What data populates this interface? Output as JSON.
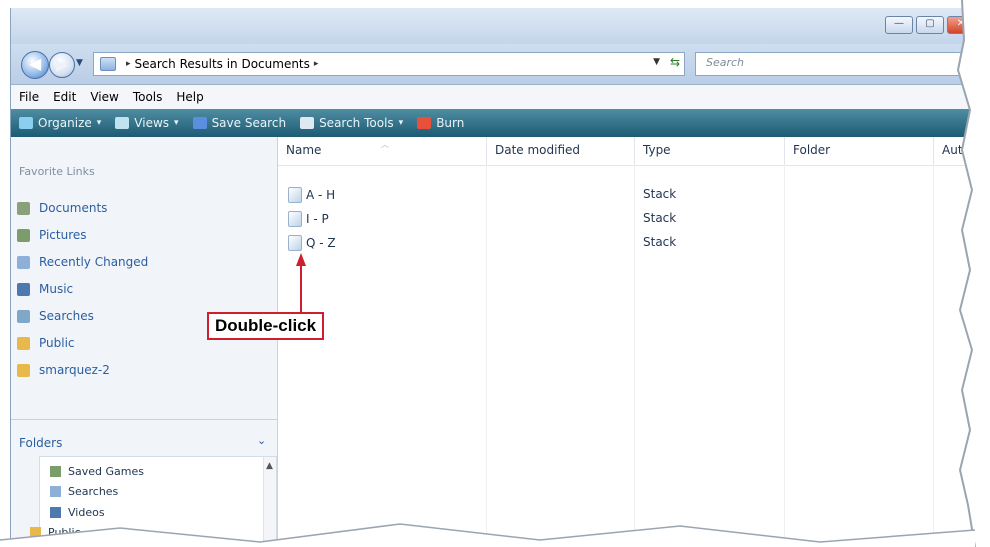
{
  "window": {
    "controls": {
      "minimize": "—",
      "maximize": "▢",
      "close": "✕"
    }
  },
  "navigation": {
    "back_icon": "back-arrow-icon",
    "forward_icon": "forward-arrow-icon",
    "address_path": "Search Results in Documents",
    "crumb_separator": "▸",
    "search_placeholder": "Search"
  },
  "menu": [
    "File",
    "Edit",
    "View",
    "Tools",
    "Help"
  ],
  "toolbar": [
    {
      "label": "Organize",
      "icon": "organize-icon",
      "dropdown": true,
      "color": "#8ad0ee"
    },
    {
      "label": "Views",
      "icon": "views-icon",
      "dropdown": true,
      "color": "#bfe3f1"
    },
    {
      "label": "Save Search",
      "icon": "save-search-icon",
      "dropdown": false,
      "color": "#5a8fe0"
    },
    {
      "label": "Search Tools",
      "icon": "search-tools-icon",
      "dropdown": true,
      "color": "#e0e8f0"
    },
    {
      "label": "Burn",
      "icon": "burn-icon",
      "dropdown": false,
      "color": "#e8503a"
    }
  ],
  "favorite_links": {
    "header": "Favorite Links",
    "items": [
      {
        "label": "Documents",
        "icon": "documents-icon",
        "color": "#8aa07a"
      },
      {
        "label": "Pictures",
        "icon": "pictures-icon",
        "color": "#7b9c6b"
      },
      {
        "label": "Recently Changed",
        "icon": "recently-changed-icon",
        "color": "#8db0d8"
      },
      {
        "label": "Music",
        "icon": "music-icon",
        "color": "#4e78b0"
      },
      {
        "label": "Searches",
        "icon": "searches-icon",
        "color": "#7fa8c8"
      },
      {
        "label": "Public",
        "icon": "public-folder-icon",
        "color": "#e8b84a"
      },
      {
        "label": "smarquez-2",
        "icon": "user-folder-icon",
        "color": "#e8b84a"
      }
    ]
  },
  "folders": {
    "header": "Folders",
    "collapse_glyph": "⌄",
    "scroll_up_glyph": "▲",
    "items": [
      {
        "label": "Saved Games",
        "icon": "saved-games-icon",
        "color": "#7b9c6b"
      },
      {
        "label": "Searches",
        "icon": "searches-icon",
        "color": "#8db0d8"
      },
      {
        "label": "Videos",
        "icon": "videos-icon",
        "color": "#4e78b0"
      },
      {
        "label": "Public",
        "icon": "public-folder-icon",
        "color": "#e8b84a"
      }
    ]
  },
  "columns": [
    "Name",
    "Date modified",
    "Type",
    "Folder",
    "Auth"
  ],
  "rows": [
    {
      "name": "A - H",
      "type": "Stack"
    },
    {
      "name": "I - P",
      "type": "Stack"
    },
    {
      "name": "Q - Z",
      "type": "Stack"
    }
  ],
  "callout": {
    "text": "Double-click",
    "color": "#d01f2c"
  }
}
